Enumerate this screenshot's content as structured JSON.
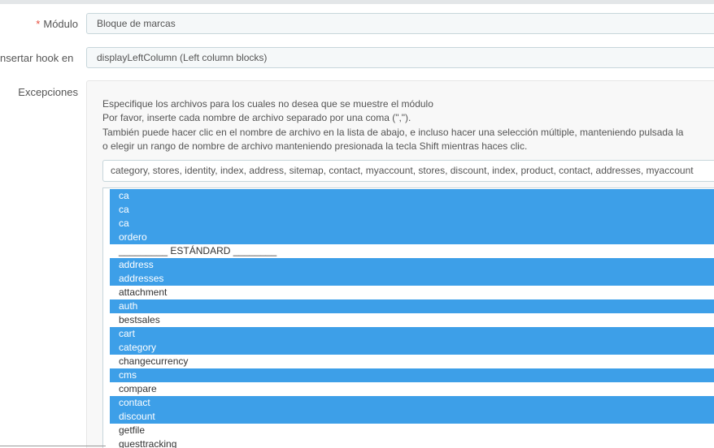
{
  "module_row": {
    "required_marker": "*",
    "label": "Módulo",
    "value": "Bloque de marcas"
  },
  "hook_row": {
    "label": "nsertar hook en",
    "value": "displayLeftColumn (Left column blocks)"
  },
  "exceptions": {
    "label": "Excepciones",
    "help_lines": [
      "Especifique los archivos para los cuales no desea que se muestre el módulo",
      "Por favor, inserte cada nombre de archivo separado por una coma (\",\").",
      "También puede hacer clic en el nombre de archivo en la lista de abajo, e incluso hacer una selección múltiple, manteniendo pulsada la",
      "o elegir un rango de nombre de archivo manteniendo presionada la tecla Shift mientras haces clic."
    ],
    "input_value": "category, stores, identity, index, address, sitemap, contact, myaccount, stores, discount, index, product, contact, addresses, myaccount",
    "options": [
      {
        "label": "ca",
        "selected": true
      },
      {
        "label": "ca",
        "selected": true
      },
      {
        "label": "ca",
        "selected": true
      },
      {
        "label": "ordero",
        "selected": true
      },
      {
        "label": "_________ ESTÁNDARD ________",
        "selected": false
      },
      {
        "label": "address",
        "selected": true
      },
      {
        "label": "addresses",
        "selected": true
      },
      {
        "label": "attachment",
        "selected": false
      },
      {
        "label": "auth",
        "selected": true
      },
      {
        "label": "bestsales",
        "selected": false
      },
      {
        "label": "cart",
        "selected": true
      },
      {
        "label": "category",
        "selected": true
      },
      {
        "label": "changecurrency",
        "selected": false
      },
      {
        "label": "cms",
        "selected": true
      },
      {
        "label": "compare",
        "selected": false
      },
      {
        "label": "contact",
        "selected": true
      },
      {
        "label": "discount",
        "selected": true
      },
      {
        "label": "getfile",
        "selected": false
      },
      {
        "label": "guesttracking",
        "selected": false
      }
    ]
  },
  "colors": {
    "selected_bg": "#3d9fe8",
    "required_star": "#e74c3c",
    "field_border": "#c7d6db"
  }
}
